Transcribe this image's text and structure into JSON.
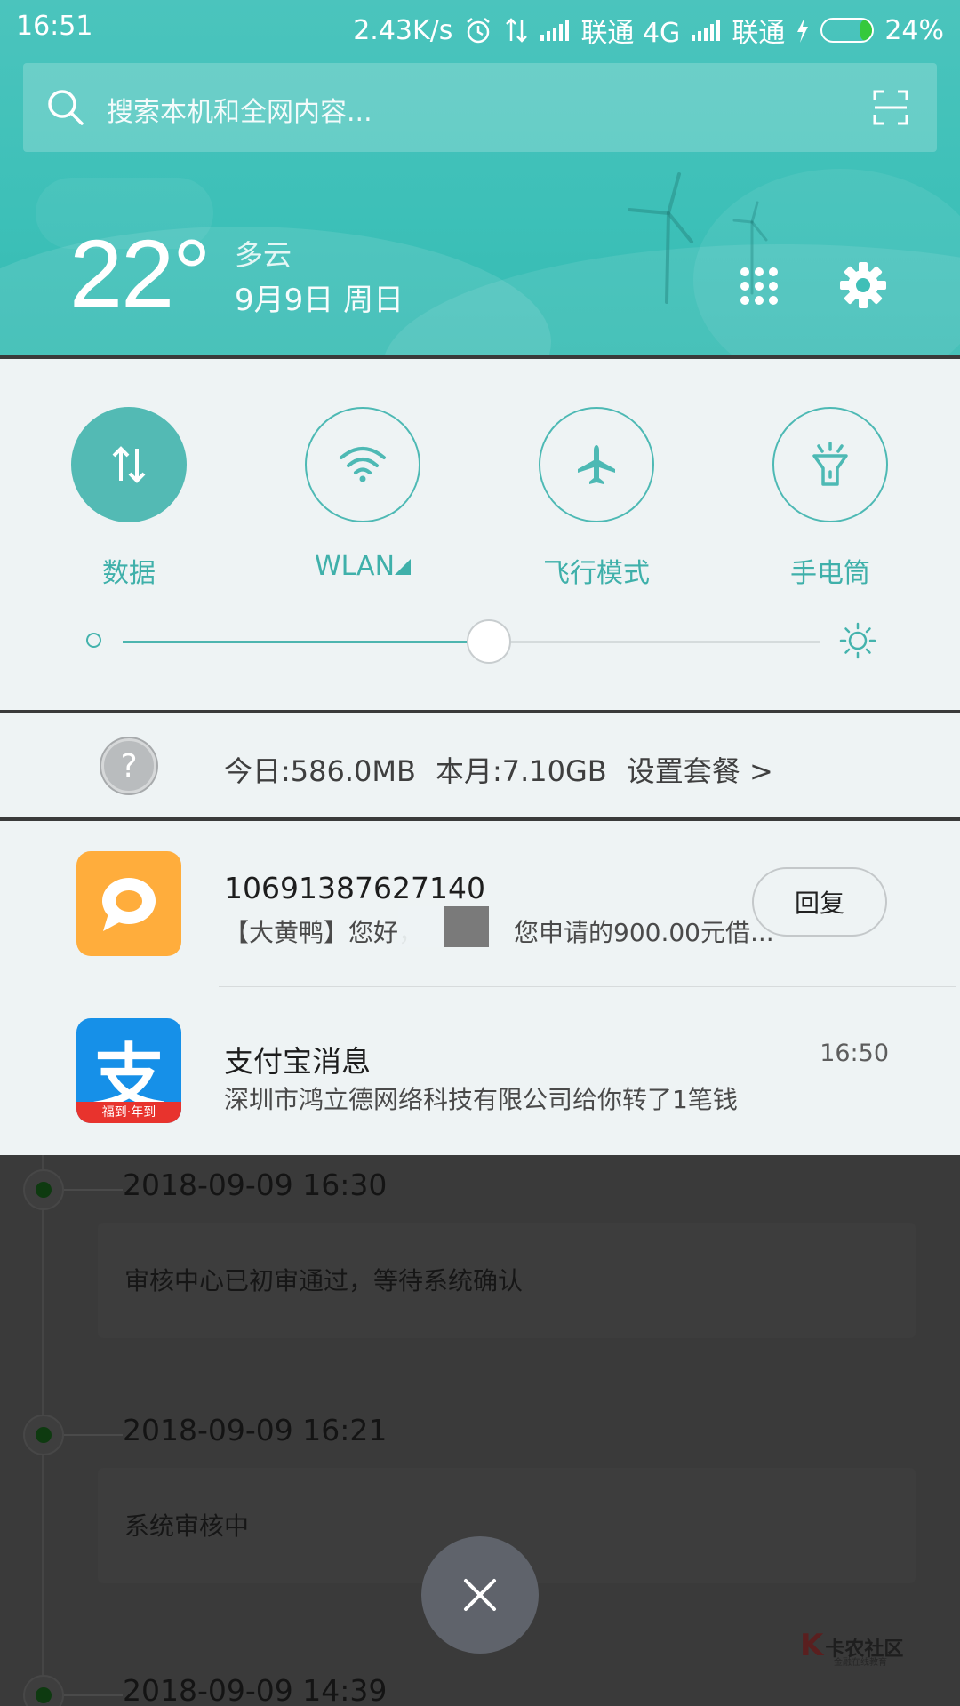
{
  "status_bar": {
    "time": "16:51",
    "net_speed": "2.43K/s",
    "carrier1": "联通 4G",
    "carrier2": "联通",
    "battery": "24%",
    "battery_level": 0.24
  },
  "search": {
    "placeholder": "搜索本机和全网内容..."
  },
  "weather": {
    "temp": "22°",
    "condition": "多云",
    "date": "9月9日 周日"
  },
  "toggles": [
    {
      "label": "数据",
      "on": true
    },
    {
      "label": "WLAN",
      "on": false
    },
    {
      "label": "飞行模式",
      "on": false
    },
    {
      "label": "手电筒",
      "on": false
    }
  ],
  "brightness": {
    "level": 0.525
  },
  "data_usage": {
    "today": "今日:586.0MB",
    "month": "本月:7.10GB",
    "action": "设置套餐 >"
  },
  "notifications": [
    {
      "title": "10691387627140",
      "body_start": "【大黄鸭】您好，",
      "body_end": "您申请的900.00元借...",
      "reply_label": "回复"
    },
    {
      "title": "支付宝消息",
      "body": "深圳市鸿立德网络科技有限公司给你转了1笔钱",
      "time": "16:50",
      "icon_char": "支",
      "icon_banner": "福到·年到"
    }
  ],
  "background_timeline": [
    {
      "date": "2018-09-09 16:30",
      "text": "审核中心已初审通过，等待系统确认"
    },
    {
      "date": "2018-09-09 16:21",
      "text": "系统审核中"
    },
    {
      "date": "2018-09-09 14:39"
    }
  ],
  "watermark": {
    "text": "卡农社区",
    "subtext": "金融在线教育"
  },
  "colors": {
    "accent": "#4db9b4",
    "header": "#3dc0b8",
    "panel": "#eef3f4"
  }
}
